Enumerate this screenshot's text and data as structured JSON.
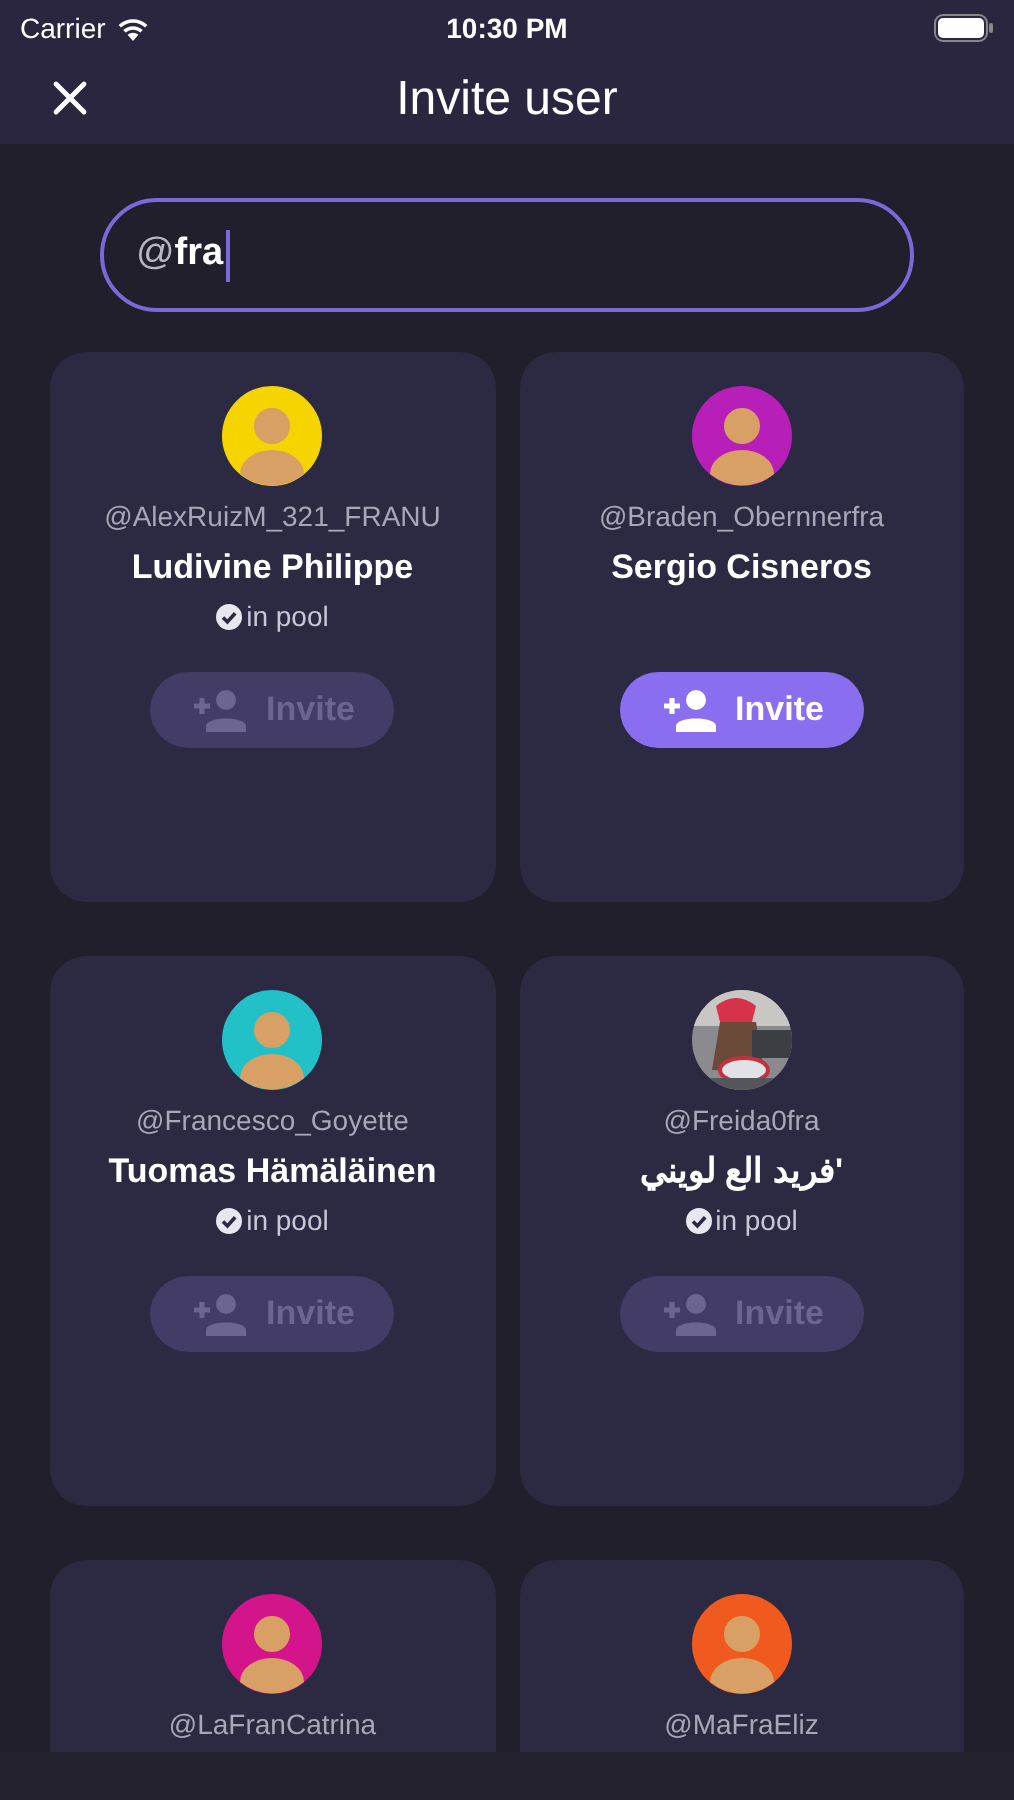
{
  "status_bar": {
    "carrier": "Carrier",
    "time": "10:30 PM"
  },
  "header": {
    "title": "Invite user"
  },
  "search": {
    "value": "@**fra**"
  },
  "users": [
    {
      "handle": "@AlexRuizM_321_FRANU",
      "name": "Ludivine Philippe",
      "in_pool": true,
      "in_pool_label": "in pool",
      "invite": {
        "label": "Invite",
        "disabled": true
      },
      "avatar": {
        "kind": "illustration",
        "color": "#f5d400"
      }
    },
    {
      "handle": "@Braden_Obernnerfra",
      "name": "Sergio Cisneros",
      "in_pool": false,
      "invite": {
        "label": "Invite",
        "disabled": false
      },
      "avatar": {
        "kind": "illustration",
        "color": "#b81fb8"
      }
    },
    {
      "handle": "@Francesco_Goyette",
      "name": "Tuomas Hämäläinen",
      "in_pool": true,
      "in_pool_label": "in pool",
      "invite": {
        "label": "Invite",
        "disabled": true
      },
      "avatar": {
        "kind": "illustration",
        "color": "#22c1c8"
      }
    },
    {
      "handle": "@Freida0fra",
      "name": "فريد الع لويني'",
      "in_pool": true,
      "in_pool_label": "in pool",
      "invite": {
        "label": "Invite",
        "disabled": true
      }
    },
    {
      "handle": "@LaFranCatrina",
      "avatar": {
        "kind": "illustration",
        "color": "#d4148a"
      }
    },
    {
      "handle": "@MaFraEliz",
      "avatar": {
        "kind": "illustration",
        "color": "#f05a1e"
      }
    }
  ]
}
